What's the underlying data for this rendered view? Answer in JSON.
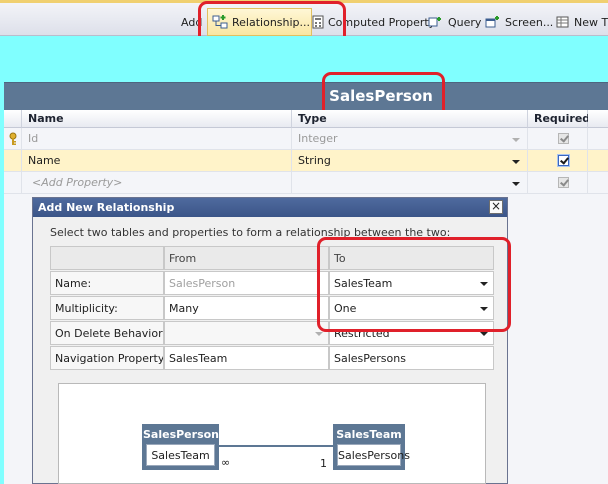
{
  "toolbar": {
    "add_label": "Add",
    "relationship_label": "Relationship...",
    "computed_property_label": "Computed Property",
    "query_label": "Query",
    "screen_label": "Screen...",
    "new_table_label": "New T"
  },
  "entity": {
    "title": "SalesPerson"
  },
  "grid": {
    "headers": {
      "name": "Name",
      "type": "Type",
      "required": "Required"
    },
    "rows": [
      {
        "name": "Id",
        "type": "Integer",
        "required": true
      },
      {
        "name": "Name",
        "type": "String",
        "required": true
      },
      {
        "name": "<Add Property>",
        "type": "",
        "required": true
      }
    ]
  },
  "dialog": {
    "title": "Add New Relationship",
    "close_glyph": "×",
    "description": "Select two tables and properties to form a relationship between the two:",
    "col_from": "From",
    "col_to": "To",
    "rows": [
      {
        "label": "Name:",
        "from": "SalesPerson",
        "to": "SalesTeam"
      },
      {
        "label": "Multiplicity:",
        "from": "Many",
        "to": "One"
      },
      {
        "label": "On Delete Behavior:",
        "from": "",
        "to": "Restricted"
      },
      {
        "label": "Navigation Property:",
        "from": "SalesTeam",
        "to": "SalesPersons"
      }
    ]
  },
  "diagram": {
    "left_entity": {
      "title": "SalesPerson",
      "property": "SalesTeam"
    },
    "right_entity": {
      "title": "SalesTeam",
      "property": "SalesPersons"
    },
    "left_multiplicity": "∞",
    "right_multiplicity": "1"
  },
  "icons": {
    "key": "key-icon",
    "relationship": "relationship-icon",
    "computed": "computed-property-icon",
    "query": "query-icon",
    "screen": "screen-icon",
    "new_table": "table-icon"
  },
  "colors": {
    "designer_bg": "#80ffff",
    "entity_header": "#5d7794",
    "highlight": "#e0202a",
    "selected_row": "#fff3c9",
    "dialog_title": "#3b5588"
  }
}
